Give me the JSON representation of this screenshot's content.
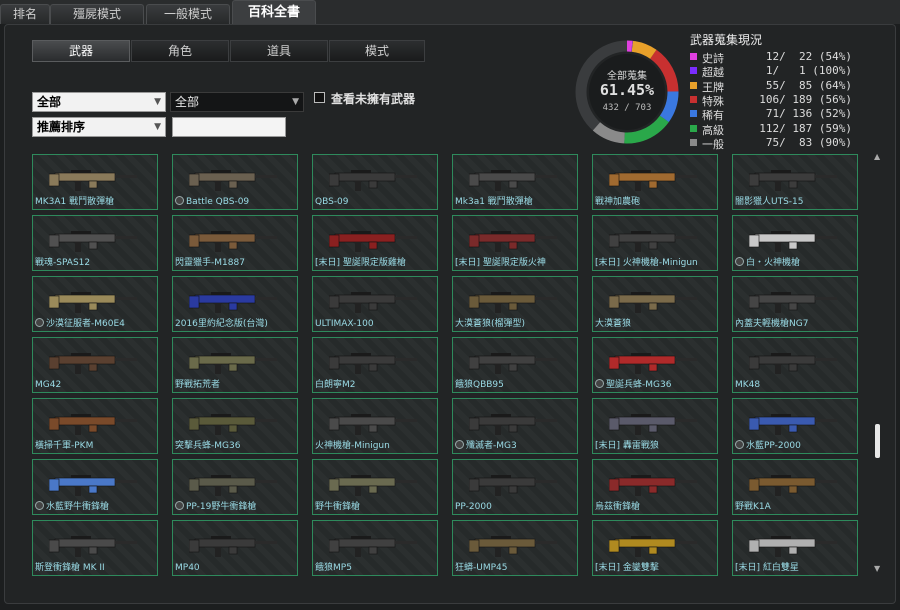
{
  "top_tabs": [
    {
      "label": "排名",
      "active": false
    },
    {
      "label": "殭屍模式",
      "active": false
    },
    {
      "label": "一般模式",
      "active": false
    },
    {
      "label": "百科全書",
      "active": true
    }
  ],
  "sub_tabs": [
    {
      "label": "武器",
      "active": true
    },
    {
      "label": "角色",
      "active": false
    },
    {
      "label": "道具",
      "active": false
    },
    {
      "label": "模式",
      "active": false
    }
  ],
  "filters": {
    "category": "全部",
    "subcategory": "全部",
    "sort": "推薦排序",
    "search_value": "",
    "show_unowned_label": "查看未擁有武器"
  },
  "collection": {
    "donut_title": "全部蒐集",
    "percent": "61.45%",
    "count": "432 / 703",
    "fraction": 0.6145,
    "legend_title": "武器蒐集現況",
    "legend": [
      {
        "name": "史詩",
        "count": "12/  22 (54%)",
        "color": "#e040e0",
        "owned": 12,
        "total": 22
      },
      {
        "name": "超越",
        "count": " 1/   1 (100%)",
        "color": "#7a2cff",
        "owned": 1,
        "total": 1
      },
      {
        "name": "王牌",
        "count": "55/  85 (64%)",
        "color": "#e8a02a",
        "owned": 55,
        "total": 85
      },
      {
        "name": "特殊",
        "count": "106/ 189 (56%)",
        "color": "#c83030",
        "owned": 106,
        "total": 189
      },
      {
        "name": "稀有",
        "count": " 71/ 136 (52%)",
        "color": "#3a78e0",
        "owned": 71,
        "total": 136
      },
      {
        "name": "高級",
        "count": "112/ 187 (59%)",
        "color": "#2aa84a",
        "owned": 112,
        "total": 187
      },
      {
        "name": "一般",
        "count": " 75/  83 (90%)",
        "color": "#8a8a8a",
        "owned": 75,
        "total": 83
      }
    ]
  },
  "weapons": [
    {
      "name": "MK3A1 戰鬥散彈槍",
      "badge": false,
      "color": "#8a7a5a"
    },
    {
      "name": "Battle QBS-09",
      "badge": true,
      "color": "#6a6050"
    },
    {
      "name": "QBS-09",
      "badge": false,
      "color": "#3a3a3a"
    },
    {
      "name": "Mk3a1 戰鬥散彈槍",
      "badge": false,
      "color": "#4a4a4a"
    },
    {
      "name": "戰神加農砲",
      "badge": false,
      "color": "#a06a30"
    },
    {
      "name": "闇影獵人UTS-15",
      "badge": false,
      "color": "#3c3c3c"
    },
    {
      "name": "戰魂-SPAS12",
      "badge": false,
      "color": "#505050"
    },
    {
      "name": "閃靈獵手-M1887",
      "badge": false,
      "color": "#7a5a3a"
    },
    {
      "name": "[末日] 聖誕限定版雞槍",
      "badge": false,
      "color": "#8a2020"
    },
    {
      "name": "[末日] 聖誕限定版火神",
      "badge": false,
      "color": "#7a2a2a"
    },
    {
      "name": "[末日] 火神機槍-Minigun",
      "badge": false,
      "color": "#404040"
    },
    {
      "name": "白・火神機槍",
      "badge": true,
      "color": "#c8c8c8"
    },
    {
      "name": "沙漠征服者-M60E4",
      "badge": true,
      "color": "#9a8a5a"
    },
    {
      "name": "2016里約紀念版(台灣)",
      "badge": false,
      "color": "#2a3aa0"
    },
    {
      "name": "ULTIMAX-100",
      "badge": false,
      "color": "#3a3a3a"
    },
    {
      "name": "大漠蒼狼(榴彈型)",
      "badge": false,
      "color": "#6a5a3a"
    },
    {
      "name": "大漠蒼狼",
      "badge": false,
      "color": "#7a6a4a"
    },
    {
      "name": "內蓋夫輕機槍NG7",
      "badge": false,
      "color": "#454545"
    },
    {
      "name": "MG42",
      "badge": false,
      "color": "#5a4030"
    },
    {
      "name": "野戰拓荒者",
      "badge": false,
      "color": "#6a6a4a"
    },
    {
      "name": "白朗寧M2",
      "badge": false,
      "color": "#3a3a3a"
    },
    {
      "name": "餓狼QBB95",
      "badge": false,
      "color": "#404040"
    },
    {
      "name": "聖誕兵蜂-MG36",
      "badge": true,
      "color": "#b02a2a"
    },
    {
      "name": "MK48",
      "badge": false,
      "color": "#3a3a3a"
    },
    {
      "name": "橫掃千軍-PKM",
      "badge": false,
      "color": "#7a4a2a"
    },
    {
      "name": "突擊兵蜂-MG36",
      "badge": false,
      "color": "#5a5a3a"
    },
    {
      "name": "火神機槍-Minigun",
      "badge": false,
      "color": "#4a4a4a"
    },
    {
      "name": "殲滅者-MG3",
      "badge": true,
      "color": "#3a3a3a"
    },
    {
      "name": "[末日] 轟雷戰狼",
      "badge": false,
      "color": "#5a5a6a"
    },
    {
      "name": "水藍PP-2000",
      "badge": true,
      "color": "#3a5ab0"
    },
    {
      "name": "水藍野牛衝鋒槍",
      "badge": true,
      "color": "#4a78c8"
    },
    {
      "name": "PP-19野牛衝鋒槍",
      "badge": true,
      "color": "#5a5a4a"
    },
    {
      "name": "野牛衝鋒槍",
      "badge": false,
      "color": "#6a6a50"
    },
    {
      "name": "PP-2000",
      "badge": false,
      "color": "#3a3a3a"
    },
    {
      "name": "烏茲衝鋒槍",
      "badge": false,
      "color": "#8a2a2a"
    },
    {
      "name": "野戰K1A",
      "badge": false,
      "color": "#7a5a30"
    },
    {
      "name": "斯登衝鋒槍 MK II",
      "badge": false,
      "color": "#4a4a4a"
    },
    {
      "name": "MP40",
      "badge": false,
      "color": "#3a3a3a"
    },
    {
      "name": "餓狼MP5",
      "badge": false,
      "color": "#404040"
    },
    {
      "name": "狂蟒-UMP45",
      "badge": false,
      "color": "#6a5a3a"
    },
    {
      "name": "[末日] 金鑾雙擊",
      "badge": false,
      "color": "#b08a20"
    },
    {
      "name": "[末日] 紅白雙星",
      "badge": false,
      "color": "#b0b0b0"
    }
  ]
}
